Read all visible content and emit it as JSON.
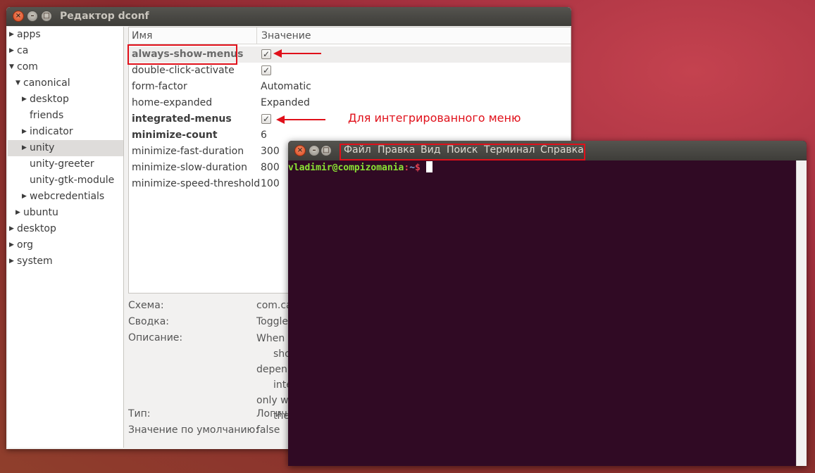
{
  "dconf": {
    "title": "Редактор dconf",
    "tree": [
      {
        "label": "apps",
        "expander": "▶"
      },
      {
        "label": "ca",
        "expander": "▶"
      },
      {
        "label": "com",
        "expander": "▼"
      },
      {
        "label": "canonical",
        "expander": "▼"
      },
      {
        "label": "desktop",
        "expander": "▶"
      },
      {
        "label": "friends",
        "expander": ""
      },
      {
        "label": "indicator",
        "expander": "▶"
      },
      {
        "label": "unity",
        "expander": "▶",
        "selected": true
      },
      {
        "label": "unity-greeter",
        "expander": ""
      },
      {
        "label": "unity-gtk-module",
        "expander": ""
      },
      {
        "label": "webcredentials",
        "expander": "▶"
      },
      {
        "label": "ubuntu",
        "expander": "▶"
      },
      {
        "label": "desktop",
        "expander": "▶"
      },
      {
        "label": "org",
        "expander": "▶"
      },
      {
        "label": "system",
        "expander": "▶"
      }
    ],
    "columns": {
      "name": "Имя",
      "value": "Значение"
    },
    "keys": [
      {
        "name": "always-show-menus",
        "value": "✓",
        "bold": true,
        "checkbox": true
      },
      {
        "name": "double-click-activate",
        "value": "✓",
        "bold": false,
        "checkbox": true
      },
      {
        "name": "form-factor",
        "value": "Automatic",
        "bold": false,
        "checkbox": false
      },
      {
        "name": "home-expanded",
        "value": "Expanded",
        "bold": false,
        "checkbox": false
      },
      {
        "name": "integrated-menus",
        "value": "✓",
        "bold": true,
        "checkbox": true
      },
      {
        "name": "minimize-count",
        "value": "6",
        "bold": true,
        "checkbox": false
      },
      {
        "name": "minimize-fast-duration",
        "value": "300",
        "bold": false,
        "checkbox": false
      },
      {
        "name": "minimize-slow-duration",
        "value": "800",
        "bold": false,
        "checkbox": false
      },
      {
        "name": "minimize-speed-threshold",
        "value": "100",
        "bold": false,
        "checkbox": false
      }
    ],
    "info": {
      "schema_label": "Схема:",
      "schema_value": "com.ca",
      "summary_label": "Сводка:",
      "summary_value": "Toggle",
      "desc_label": "Описание:",
      "desc_lines": [
        "When t",
        "sho",
        "depen",
        "inte",
        "only wh",
        "the"
      ],
      "type_label": "Тип:",
      "type_value": "Логич",
      "default_label": "Значение по умолчанию:",
      "default_value": "false"
    }
  },
  "annotation": {
    "text": "Для интегрированного меню",
    "color": "#e0101a"
  },
  "terminal": {
    "menu": [
      "Файл",
      "Правка",
      "Вид",
      "Поиск",
      "Терминал",
      "Справка"
    ],
    "prompt_user": "vladimir@compizomania",
    "prompt_path": "~",
    "prompt_sign": "$",
    "bg_color": "#300a24"
  },
  "window_buttons": {
    "close": "×",
    "minimize": "–",
    "maximize": "□"
  }
}
